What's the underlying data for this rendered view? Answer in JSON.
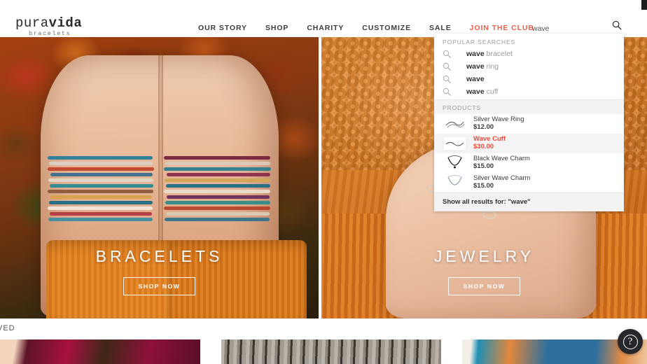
{
  "header": {
    "logo_main_pura": "pura",
    "logo_main_vida": "vida",
    "logo_sub": "bracelets",
    "nav": [
      {
        "label": "OUR STORY",
        "accent": false
      },
      {
        "label": "SHOP",
        "accent": false
      },
      {
        "label": "CHARITY",
        "accent": false
      },
      {
        "label": "CUSTOMIZE",
        "accent": false
      },
      {
        "label": "SALE",
        "accent": false
      },
      {
        "label": "JOIN THE CLUB",
        "accent": true
      }
    ],
    "accent_color": "#f0604d"
  },
  "search": {
    "value": "wave",
    "placeholder": "Search",
    "icon": "search-icon"
  },
  "dropdown": {
    "popular_label": "POPULAR SEARCHES",
    "popular": [
      {
        "bold": "wave",
        "rest": " bracelet"
      },
      {
        "bold": "wave",
        "rest": " ring"
      },
      {
        "bold": "wave",
        "rest": ""
      },
      {
        "bold": "wave",
        "rest": " cuff"
      }
    ],
    "products_label": "PRODUCTS",
    "products": [
      {
        "name": "Silver Wave Ring",
        "price": "$12.00",
        "highlighted": false,
        "thumb": "silver-wave-ring-thumb"
      },
      {
        "name": "Wave Cuff",
        "price": "$30.00",
        "highlighted": true,
        "thumb": "wave-cuff-thumb"
      },
      {
        "name": "Black Wave Charm",
        "price": "$15.00",
        "highlighted": false,
        "thumb": "black-wave-charm-thumb"
      },
      {
        "name": "Silver Wave Charm",
        "price": "$15.00",
        "highlighted": false,
        "thumb": "silver-wave-charm-thumb"
      }
    ],
    "footer_label": "Show all results for: \"wave\"",
    "highlight_color": "#f0483a"
  },
  "hero": {
    "left": {
      "title": "BRACELETS",
      "cta": "SHOP NOW"
    },
    "right": {
      "title": "JEWELRY",
      "cta": "SHOP NOW"
    }
  },
  "bottom": {
    "section_label": "VED",
    "help_badge": "?"
  }
}
